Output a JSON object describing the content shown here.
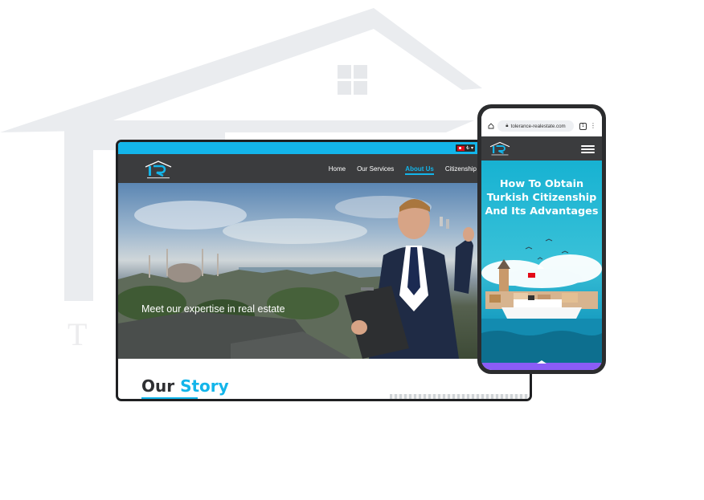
{
  "colors": {
    "accent": "#13b5ea",
    "nav_bg": "#3b3c3e",
    "phone_footer": "#8b5cf6"
  },
  "background": {
    "logo_letters": "T O"
  },
  "desktop": {
    "topbar": {
      "flag": "turkey-flag-icon",
      "currency": "₺"
    },
    "nav": {
      "items": [
        {
          "label": "Home",
          "active": false
        },
        {
          "label": "Our Services",
          "active": false
        },
        {
          "label": "About Us",
          "active": true
        },
        {
          "label": "Citizenship",
          "active": false
        }
      ]
    },
    "hero": {
      "text": "Meet our expertise in real estate"
    },
    "story": {
      "word1": "Our",
      "word2": "Story"
    }
  },
  "phone": {
    "browser": {
      "url": "tolerance-realestate.com",
      "tab_count": "1"
    },
    "hero": {
      "title_lines": [
        "How To Obtain",
        "Turkish Citizenship",
        "And Its Advantages"
      ]
    }
  }
}
